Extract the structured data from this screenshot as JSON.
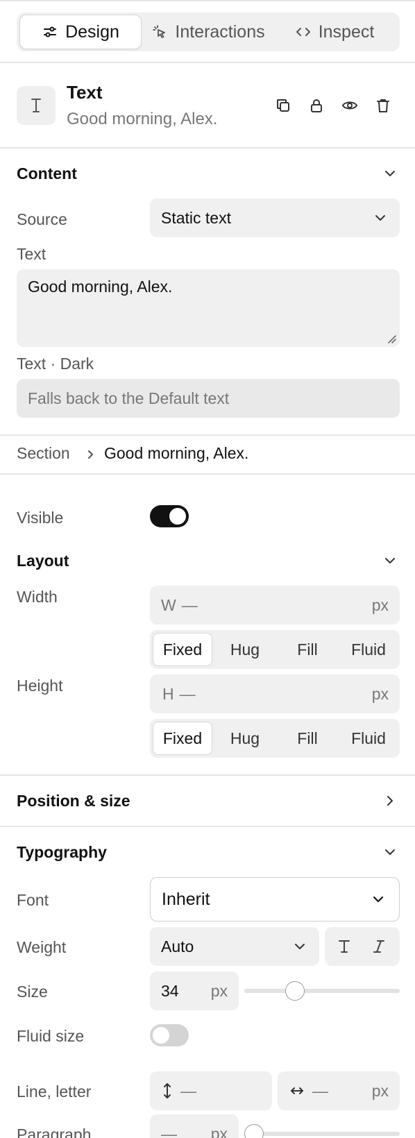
{
  "tabs": [
    {
      "label": "Design",
      "icon": "sliders-icon",
      "active": true
    },
    {
      "label": "Interactions",
      "icon": "pointer-click-icon",
      "active": false
    },
    {
      "label": "Inspect",
      "icon": "code-brackets-icon",
      "active": false
    }
  ],
  "element": {
    "type_icon": "text-type-icon",
    "title": "Text",
    "subtitle": "Good morning, Alex.",
    "actions": [
      "duplicate-icon",
      "lock-icon",
      "eye-icon",
      "trash-icon"
    ]
  },
  "content": {
    "title": "Content",
    "source_label": "Source",
    "source_value": "Static text",
    "text_label": "Text",
    "text_value": "Good morning, Alex.",
    "dark_label": "Text · Dark",
    "dark_placeholder": "Falls back to the Default text"
  },
  "breadcrumb": {
    "parent": "Section",
    "current": "Good morning, Alex."
  },
  "visible": {
    "label": "Visible",
    "on": true
  },
  "layout": {
    "title": "Layout",
    "width_label": "Width",
    "width_prefix": "W",
    "width_value": "—",
    "width_unit": "px",
    "height_label": "Height",
    "height_prefix": "H",
    "height_value": "—",
    "height_unit": "px",
    "modes": [
      "Fixed",
      "Hug",
      "Fill",
      "Fluid"
    ],
    "width_mode": "Fixed",
    "height_mode": "Fixed"
  },
  "position_size": {
    "title": "Position & size"
  },
  "typography": {
    "title": "Typography",
    "font_label": "Font",
    "font_value": "Inherit",
    "weight_label": "Weight",
    "weight_value": "Auto",
    "size_label": "Size",
    "size_value": "34",
    "size_unit": "px",
    "size_slider_fraction": 0.3,
    "fluid_label": "Fluid size",
    "fluid_on": false,
    "line_letter_label": "Line, letter",
    "line_value": "—",
    "letter_value": "—",
    "letter_unit": "px",
    "paragraph_label": "Paragraph",
    "paragraph_value": "—",
    "paragraph_unit": "px",
    "paragraph_slider_fraction": 0.0
  },
  "colors": {
    "toggle_on": "#111111",
    "toggle_off": "#d4d4d4"
  }
}
